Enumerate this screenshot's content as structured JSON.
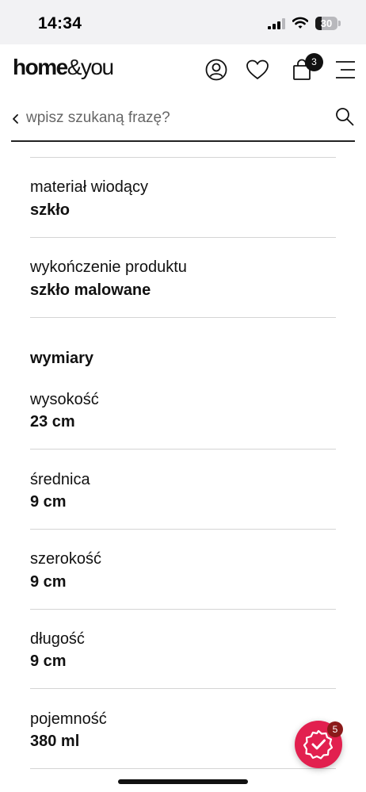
{
  "status_bar": {
    "time": "14:34",
    "battery_level": "30",
    "battery_fraction": 0.3,
    "icons": [
      "signal-icon",
      "wifi-icon",
      "battery-icon"
    ]
  },
  "header": {
    "logo_bold": "home",
    "logo_amp": "&",
    "logo_light": "you",
    "icons": [
      "account-icon",
      "heart-icon",
      "bag-icon",
      "menu-icon"
    ],
    "cart_count": "3"
  },
  "search": {
    "placeholder": "wpisz szukaną frazę?",
    "icons": [
      "chevron-left-icon",
      "search-icon"
    ]
  },
  "attributes": [
    {
      "label": "materiał wiodący",
      "value": "szkło"
    },
    {
      "label": "wykończenie produktu",
      "value": "szkło malowane"
    }
  ],
  "dimensions": {
    "title": "wymiary",
    "items": [
      {
        "label": "wysokość",
        "value": "23 cm"
      },
      {
        "label": "średnica",
        "value": "9 cm"
      },
      {
        "label": "szerokość",
        "value": "9 cm"
      },
      {
        "label": "długość",
        "value": "9 cm"
      },
      {
        "label": "pojemność",
        "value": "380 ml"
      }
    ]
  },
  "chat_widget": {
    "icon": "verified-badge-icon",
    "badge_count": "5",
    "accent_color": "#e2204f"
  }
}
